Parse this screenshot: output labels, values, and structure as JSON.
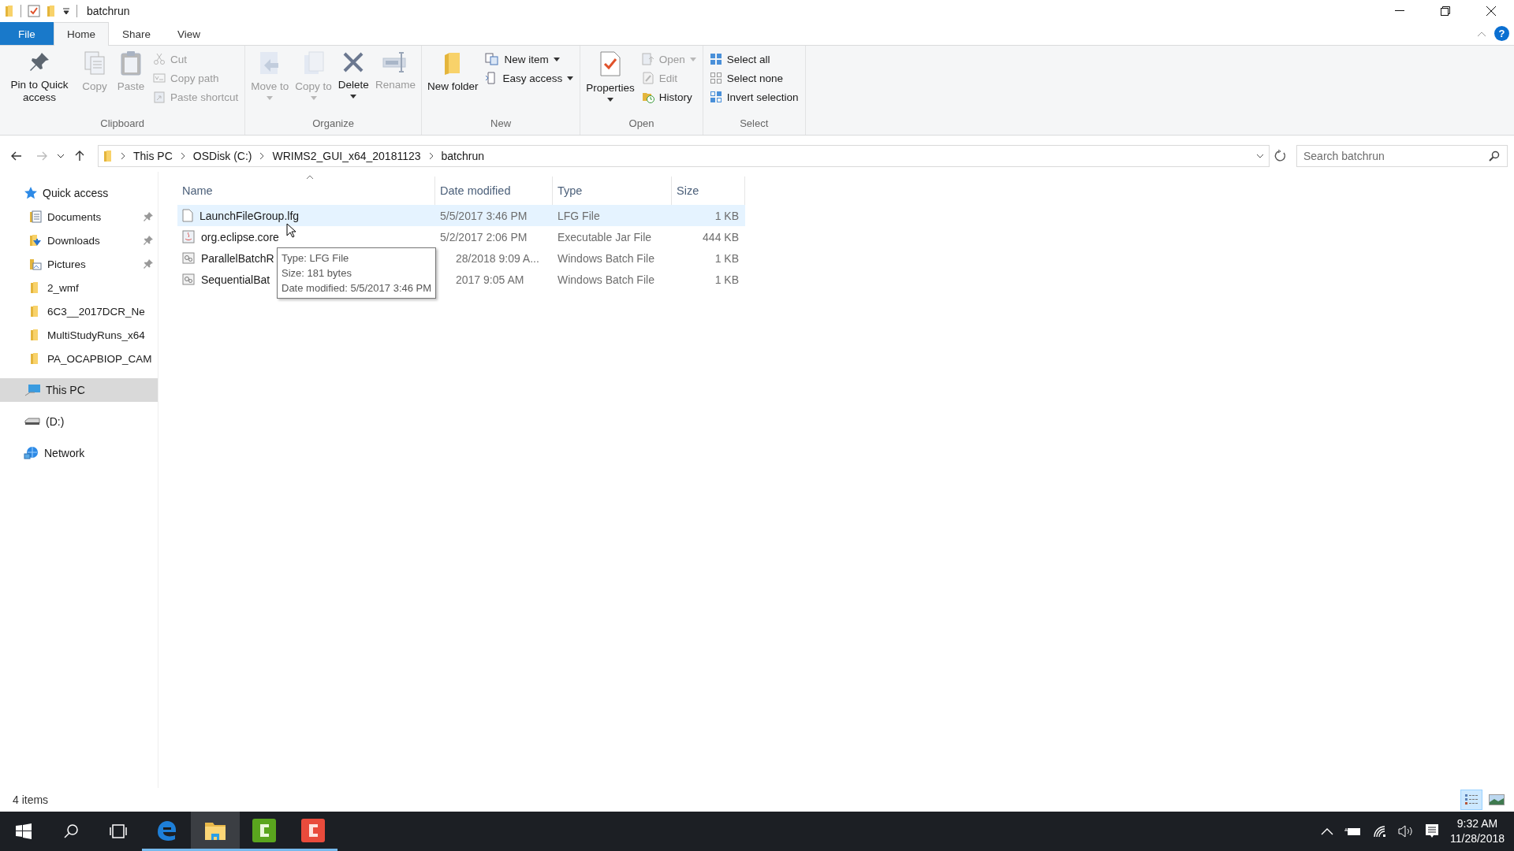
{
  "window": {
    "title": "batchrun"
  },
  "ribbon": {
    "tabs": [
      {
        "label": "File",
        "kind": "file",
        "selected": false
      },
      {
        "label": "Home",
        "kind": "tab",
        "selected": true
      },
      {
        "label": "Share",
        "kind": "tab",
        "selected": false
      },
      {
        "label": "View",
        "kind": "tab",
        "selected": false
      }
    ],
    "help": "?",
    "groups": [
      {
        "label": "Clipboard",
        "items": [
          {
            "kind": "large",
            "label": "Pin to Quick access",
            "disabled": false,
            "dropdown": false
          },
          {
            "kind": "large",
            "label": "Copy",
            "disabled": true,
            "dropdown": false
          },
          {
            "kind": "large",
            "label": "Paste",
            "disabled": true,
            "dropdown": false
          },
          {
            "kind": "small",
            "label": "Cut",
            "disabled": true,
            "dropdown": false
          },
          {
            "kind": "small",
            "label": "Copy path",
            "disabled": true,
            "dropdown": false
          },
          {
            "kind": "small",
            "label": "Paste shortcut",
            "disabled": true,
            "dropdown": false
          }
        ]
      },
      {
        "label": "Organize",
        "items": [
          {
            "kind": "large",
            "label": "Move to",
            "disabled": true,
            "dropdown": true
          },
          {
            "kind": "large",
            "label": "Copy to",
            "disabled": true,
            "dropdown": true
          },
          {
            "kind": "large",
            "label": "Delete",
            "disabled": false,
            "dropdown": true
          },
          {
            "kind": "large",
            "label": "Rename",
            "disabled": true,
            "dropdown": false
          }
        ]
      },
      {
        "label": "New",
        "items": [
          {
            "kind": "large",
            "label": "New folder",
            "disabled": false,
            "dropdown": false
          },
          {
            "kind": "small",
            "label": "New item",
            "disabled": false,
            "dropdown": true
          },
          {
            "kind": "small",
            "label": "Easy access",
            "disabled": false,
            "dropdown": true
          }
        ]
      },
      {
        "label": "Open",
        "items": [
          {
            "kind": "large",
            "label": "Properties",
            "disabled": false,
            "dropdown": true
          },
          {
            "kind": "small",
            "label": "Open",
            "disabled": true,
            "dropdown": true
          },
          {
            "kind": "small",
            "label": "Edit",
            "disabled": true,
            "dropdown": false
          },
          {
            "kind": "small",
            "label": "History",
            "disabled": false,
            "dropdown": false
          }
        ]
      },
      {
        "label": "Select",
        "items": [
          {
            "kind": "small",
            "label": "Select all",
            "disabled": false,
            "dropdown": false
          },
          {
            "kind": "small",
            "label": "Select none",
            "disabled": false,
            "dropdown": false
          },
          {
            "kind": "small",
            "label": "Invert selection",
            "disabled": false,
            "dropdown": false
          }
        ]
      }
    ]
  },
  "address": {
    "crumbs": [
      "This PC",
      "OSDisk (C:)",
      "WRIMS2_GUI_x64_20181123",
      "batchrun"
    ],
    "search": {
      "placeholder": "Search batchrun"
    }
  },
  "sidebar": {
    "items": [
      {
        "label": "Quick access",
        "kind": "star",
        "selected": false,
        "pinned": false,
        "children": [
          {
            "label": "Documents",
            "kind": "documents",
            "selected": false,
            "pinned": true
          },
          {
            "label": "Downloads",
            "kind": "downloads",
            "selected": false,
            "pinned": true
          },
          {
            "label": "Pictures",
            "kind": "pictures",
            "selected": false,
            "pinned": true
          },
          {
            "label": "2_wmf",
            "kind": "folder",
            "selected": false,
            "pinned": false
          },
          {
            "label": "6C3__2017DCR_Ne",
            "kind": "folder",
            "selected": false,
            "pinned": false
          },
          {
            "label": "MultiStudyRuns_x64",
            "kind": "folder",
            "selected": false,
            "pinned": false
          },
          {
            "label": "PA_OCAPBIOP_CAM",
            "kind": "folder",
            "selected": false,
            "pinned": false
          }
        ]
      },
      {
        "label": "This PC",
        "kind": "pc",
        "selected": true,
        "pinned": false
      },
      {
        "label": "(D:)",
        "kind": "drive",
        "selected": false,
        "pinned": false
      },
      {
        "label": "Network",
        "kind": "network",
        "selected": false,
        "pinned": false
      }
    ]
  },
  "table": {
    "columns": [
      {
        "label": "Name",
        "sorted": true
      },
      {
        "label": "Date modified",
        "sorted": false
      },
      {
        "label": "Type",
        "sorted": false
      },
      {
        "label": "Size",
        "sorted": false
      }
    ],
    "rows": [
      {
        "kind": "file",
        "name": "LaunchFileGroup.lfg",
        "date": "5/5/2017 3:46 PM",
        "type": "LFG File",
        "size": "1 KB",
        "selected": true
      },
      {
        "kind": "jar",
        "name": "org.eclipse.core",
        "date": "5/2/2017 2:06 PM",
        "type": "Executable Jar File",
        "size": "444 KB",
        "selected": false
      },
      {
        "kind": "batch",
        "name": "ParallelBatchR",
        "date": "28/2018 9:09 A...",
        "type": "Windows Batch File",
        "size": "1 KB",
        "selected": false
      },
      {
        "kind": "batch",
        "name": "SequentialBat",
        "date": "2017 9:05 AM",
        "type": "Windows Batch File",
        "size": "1 KB",
        "selected": false
      }
    ]
  },
  "tooltip": {
    "lines": [
      "Type: LFG File",
      "Size: 181 bytes",
      "Date modified: 5/5/2017 3:46 PM"
    ]
  },
  "status_bar": {
    "text": "4 items",
    "views": [
      {
        "selected": true
      },
      {
        "selected": false
      }
    ]
  },
  "taskbar": {
    "apps": [
      {
        "kind": "edge",
        "selected": false
      },
      {
        "kind": "explorer",
        "selected": true
      },
      {
        "kind": "green",
        "selected": false
      },
      {
        "kind": "red",
        "selected": false
      }
    ],
    "time": "9:32 AM",
    "date": "11/28/2018"
  }
}
